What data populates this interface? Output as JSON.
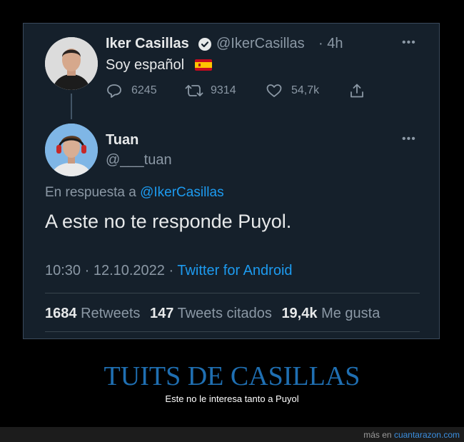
{
  "tweet": {
    "author_name": "Iker Casillas",
    "author_handle": "@IkerCasillas",
    "time_ago": "· 4h",
    "text": "Soy español",
    "flag_icon": "spain-flag-icon",
    "replies": "6245",
    "retweets": "9314",
    "likes": "54,7k"
  },
  "reply": {
    "author_name": "Tuan",
    "author_handle": "@___tuan",
    "reply_prefix": "En respuesta a",
    "reply_to": "@IkerCasillas",
    "text": "A este no te responde Puyol.",
    "timestamp": "10:30 · 12.10.2022 ·",
    "source": "Twitter for Android",
    "retweets_count": "1684",
    "retweets_label": "Retweets",
    "quotes_count": "147",
    "quotes_label": "Tweets citados",
    "likes_count": "19,4k",
    "likes_label": "Me gusta"
  },
  "caption": {
    "title": "TUITS DE CASILLAS",
    "subtitle": "Este no le interesa tanto a Puyol"
  },
  "footer": {
    "prefix": "más en",
    "site": "cuantarazon.com"
  },
  "colors": {
    "background": "#15202b",
    "link": "#1d9bf0",
    "caption_title": "#1f6fb2",
    "muted": "#8b98a5"
  }
}
